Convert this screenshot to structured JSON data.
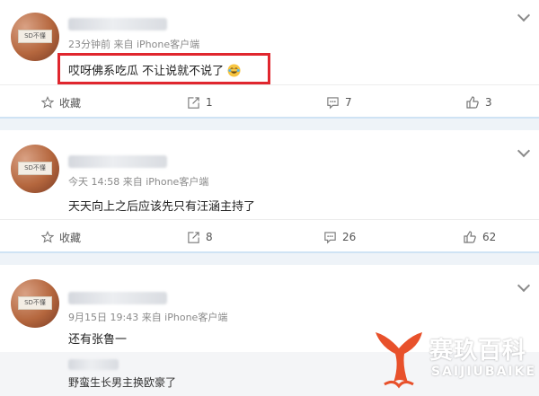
{
  "posts": [
    {
      "avatar_text": "SD不懂",
      "meta": "23分钟前 来自 iPhone客户端",
      "content": "哎呀佛系吃瓜 不让说就不说了 ",
      "actions": {
        "favorite": "收藏",
        "repost": "1",
        "comment": "7",
        "like": "3"
      }
    },
    {
      "avatar_text": "SD不懂",
      "meta": "今天 14:58 来自 iPhone客户端",
      "content": "天天向上之后应该先只有汪涵主持了",
      "actions": {
        "favorite": "收藏",
        "repost": "8",
        "comment": "26",
        "like": "62"
      }
    },
    {
      "avatar_text": "SD不懂",
      "meta": "9月15日 19:43 来自 iPhone客户端",
      "content": "还有张鲁一",
      "quote_text": "野蛮生长男主换欧豪了"
    }
  ],
  "watermark": {
    "brand": "赛玖百科",
    "sub": "SAIJIUBAIKE"
  },
  "colors": {
    "highlight": "#e0262e",
    "separator": "#cfe3f4",
    "watermark_logo": "#e8512b"
  }
}
